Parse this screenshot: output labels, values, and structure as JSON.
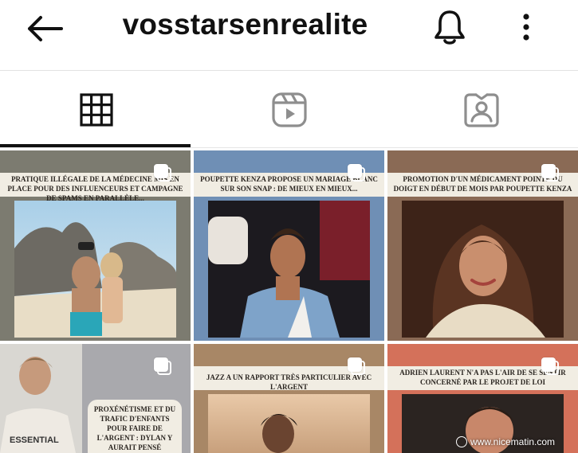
{
  "header": {
    "username": "vosstarsenrealite"
  },
  "tabs": [
    {
      "name": "grid",
      "icon": "grid-icon",
      "active": true
    },
    {
      "name": "reels",
      "icon": "reels-icon",
      "active": false
    },
    {
      "name": "tagged",
      "icon": "tagged-icon",
      "active": false
    }
  ],
  "posts": [
    {
      "headline": "Pratique illégale de la médecine mis en place pour des influenceurs et campagne de spams en parallèle...",
      "bg": "#7c7b70"
    },
    {
      "headline": "Poupette Kenza propose un mariage blanc sur son snap : de mieux en mieux...",
      "bg": "#6f8fb5"
    },
    {
      "headline": "Promotion d'un médicament pointé du doigt en début de mois par Poupette Kenza",
      "bg": "#8a6a55"
    },
    {
      "headline": "Proxénétisme et du trafic d'enfants pour faire de l'argent : Dylan y aurait pensé",
      "bg": "#a9a9ad"
    },
    {
      "headline": "Jazz a un rapport très particulier avec l'argent",
      "bg": "#a88766"
    },
    {
      "headline": "Adrien Laurent n'a pas l'air de se sentir concerné par le projet de loi",
      "bg": "#d4715a"
    }
  ],
  "watermark": "www.nicematin.com",
  "colors": {
    "text": "#111111",
    "icon_inactive": "#8e8e8e",
    "active_indicator": "#111111"
  }
}
